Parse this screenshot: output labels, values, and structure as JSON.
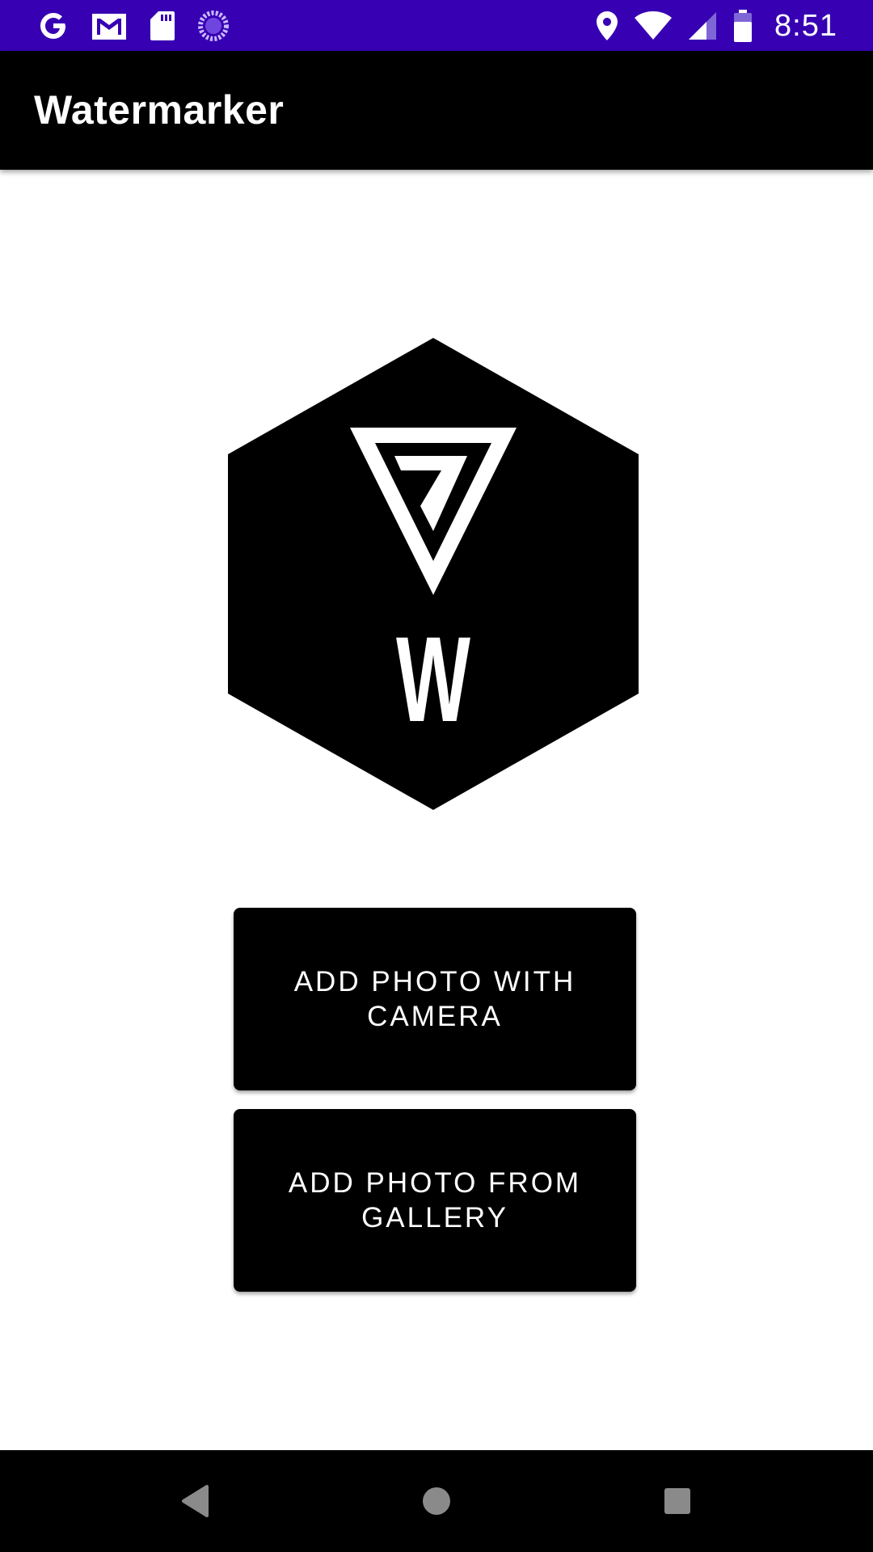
{
  "status_bar": {
    "time": "8:51",
    "left_icons": [
      "google-icon",
      "gmail-icon",
      "sd-card-icon",
      "loading-spinner-icon"
    ],
    "right_icons": [
      "location-icon",
      "wifi-icon",
      "cell-signal-icon",
      "battery-icon"
    ],
    "background_color": "#3700b3"
  },
  "app_bar": {
    "title": "Watermarker",
    "background_color": "#000000"
  },
  "logo": {
    "letter": "W"
  },
  "buttons": {
    "camera_label": "ADD PHOTO WITH CAMERA",
    "gallery_label": "ADD PHOTO FROM GALLERY"
  },
  "nav_bar": {
    "icons": [
      "back-icon",
      "home-icon",
      "recents-icon"
    ]
  }
}
